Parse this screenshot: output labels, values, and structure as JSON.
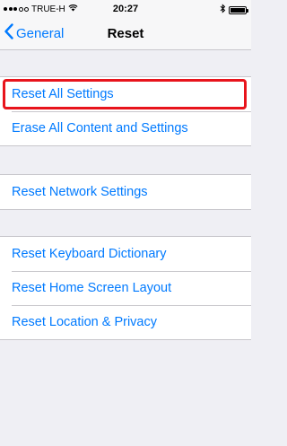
{
  "status_bar": {
    "carrier": "TRUE-H",
    "time": "20:27",
    "signal_icon": "signal-dots-icon",
    "wifi_icon": "wifi-icon",
    "bluetooth_icon": "bluetooth-icon",
    "battery_icon": "battery-icon",
    "battery_level": 1.0
  },
  "nav": {
    "back_label": "General",
    "back_icon": "chevron-left-icon",
    "title": "Reset"
  },
  "groups": [
    {
      "items": [
        {
          "label": "Reset All Settings",
          "highlighted": true
        },
        {
          "label": "Erase All Content and Settings"
        }
      ]
    },
    {
      "items": [
        {
          "label": "Reset Network Settings"
        }
      ]
    },
    {
      "items": [
        {
          "label": "Reset Keyboard Dictionary"
        },
        {
          "label": "Reset Home Screen Layout"
        },
        {
          "label": "Reset Location & Privacy"
        }
      ]
    }
  ],
  "colors": {
    "accent": "#007aff",
    "highlight": "#e8141c",
    "background": "#efeff4"
  }
}
